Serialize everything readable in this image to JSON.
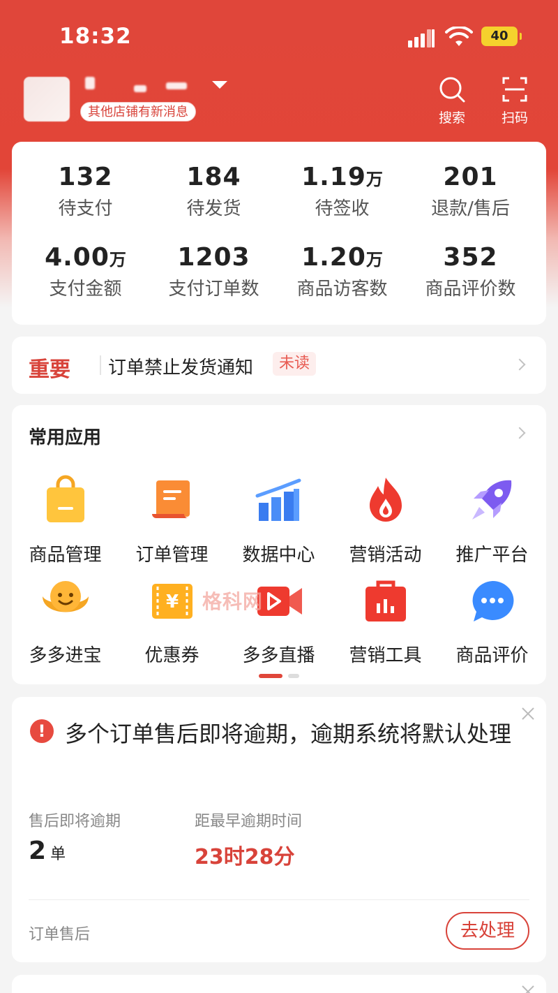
{
  "status_bar": {
    "time": "18:32",
    "battery": "40"
  },
  "header": {
    "notice": "其他店铺有新消息",
    "search_label": "搜索",
    "scan_label": "扫码"
  },
  "stats": [
    {
      "value": "132",
      "unit": "",
      "label": "待支付"
    },
    {
      "value": "184",
      "unit": "",
      "label": "待发货"
    },
    {
      "value": "1.19",
      "unit": "万",
      "label": "待签收"
    },
    {
      "value": "201",
      "unit": "",
      "label": "退款/售后"
    },
    {
      "value": "4.00",
      "unit": "万",
      "label": "支付金额"
    },
    {
      "value": "1203",
      "unit": "",
      "label": "支付订单数"
    },
    {
      "value": "1.20",
      "unit": "万",
      "label": "商品访客数"
    },
    {
      "value": "352",
      "unit": "",
      "label": "商品评价数"
    }
  ],
  "notice": {
    "tag": "重要",
    "text": "订单禁止发货通知",
    "badge": "未读"
  },
  "apps": {
    "title": "常用应用",
    "items": [
      {
        "label": "商品管理",
        "icon": "shopping-bag-icon"
      },
      {
        "label": "订单管理",
        "icon": "order-scroll-icon"
      },
      {
        "label": "数据中心",
        "icon": "bar-chart-icon"
      },
      {
        "label": "营销活动",
        "icon": "flame-icon"
      },
      {
        "label": "推广平台",
        "icon": "rocket-icon"
      },
      {
        "label": "多多进宝",
        "icon": "ingot-icon"
      },
      {
        "label": "优惠券",
        "icon": "coupon-icon"
      },
      {
        "label": "多多直播",
        "icon": "video-camera-icon"
      },
      {
        "label": "营销工具",
        "icon": "toolbox-icon"
      },
      {
        "label": "商品评价",
        "icon": "chat-bubble-icon"
      }
    ]
  },
  "watermark": "格科网",
  "alert": {
    "title": "多个订单售后即将逾期，逾期系统将默认处理",
    "metric1_label": "售后即将逾期",
    "metric1_value": "2",
    "metric1_unit": "单",
    "metric2_label": "距最早逾期时间",
    "metric2_value": "23时28分",
    "footer_label": "订单售后",
    "action": "去处理"
  },
  "colors": {
    "brand": "#e0463a",
    "accent": "#d8433a",
    "battery": "#f5d12d"
  }
}
